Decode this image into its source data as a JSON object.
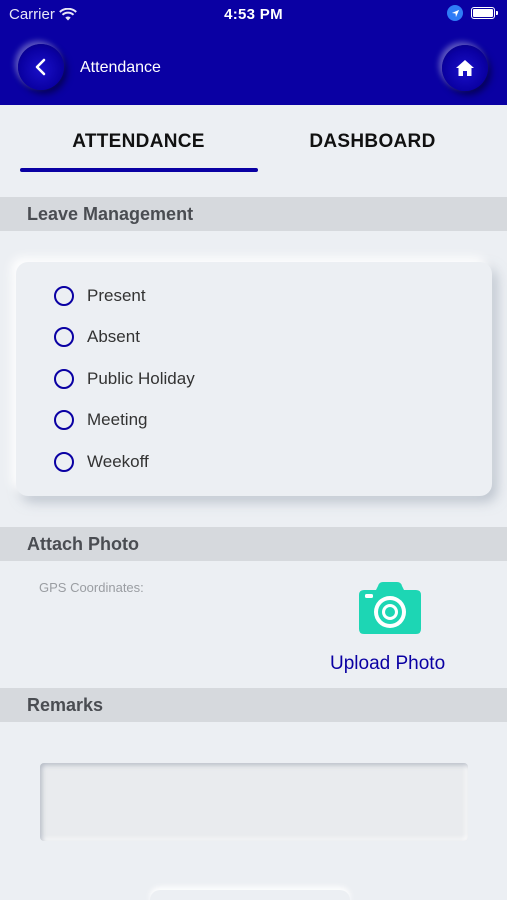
{
  "status_bar": {
    "carrier": "Carrier",
    "time": "4:53 PM"
  },
  "header": {
    "title": "Attendance",
    "back_icon": "chevron-left-icon",
    "home_icon": "home-icon"
  },
  "tabs": [
    {
      "label": "ATTENDANCE",
      "active": true
    },
    {
      "label": "DASHBOARD",
      "active": false
    }
  ],
  "leave_management": {
    "title": "Leave Management",
    "options": [
      "Present",
      "Absent",
      "Public Holiday",
      "Meeting",
      "Weekoff"
    ]
  },
  "attach_photo": {
    "title": "Attach Photo",
    "gps_label": "GPS Coordinates:",
    "upload_label": "Upload Photo",
    "camera_color": "#1dd6b4"
  },
  "remarks": {
    "title": "Remarks",
    "value": ""
  },
  "colors": {
    "primary": "#0a00a3",
    "background": "#eceff3",
    "section": "#d6d9dd"
  }
}
